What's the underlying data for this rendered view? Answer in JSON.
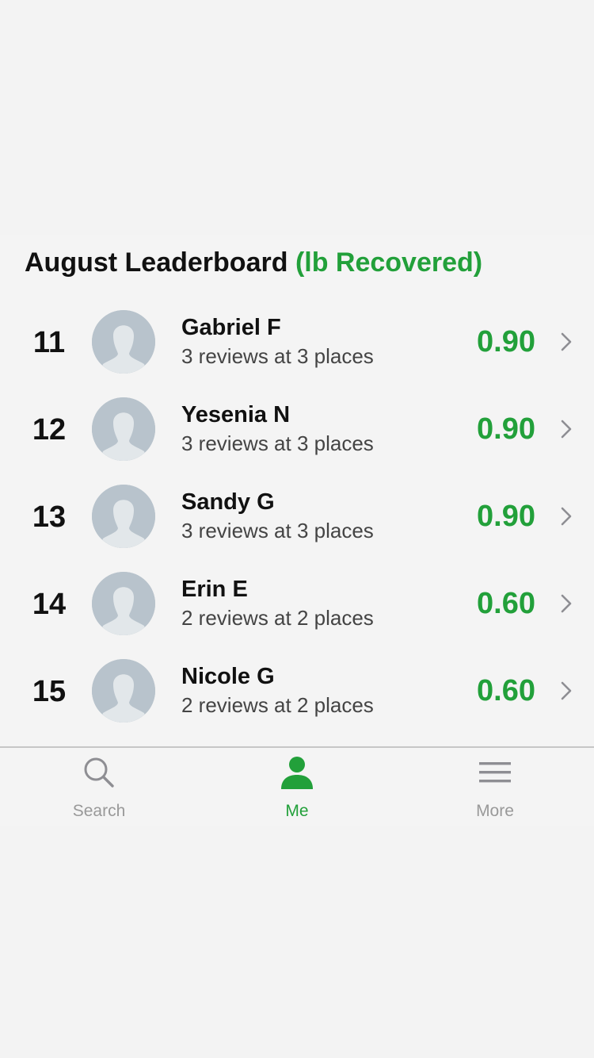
{
  "colors": {
    "accent": "#22a03a",
    "text": "#111111",
    "inactive": "#999999"
  },
  "leaderboard": {
    "title": "August Leaderboard",
    "unit": "(lb Recovered)",
    "rows": [
      {
        "rank": "11",
        "name": "Gabriel F",
        "summary": "3 reviews at 3 places",
        "score": "0.90",
        "avatar_icon": "default-avatar-icon"
      },
      {
        "rank": "12",
        "name": "Yesenia N",
        "summary": "3 reviews at 3 places",
        "score": "0.90",
        "avatar_icon": "default-avatar-icon"
      },
      {
        "rank": "13",
        "name": "Sandy G",
        "summary": "3 reviews at 3 places",
        "score": "0.90",
        "avatar_icon": "default-avatar-icon"
      },
      {
        "rank": "14",
        "name": "Erin E",
        "summary": "2 reviews at 2 places",
        "score": "0.60",
        "avatar_icon": "default-avatar-icon"
      },
      {
        "rank": "15",
        "name": "Nicole G",
        "summary": "2 reviews at 2 places",
        "score": "0.60",
        "avatar_icon": "default-avatar-icon"
      }
    ]
  },
  "tabbar": {
    "tabs": [
      {
        "label": "Search",
        "icon": "search-icon",
        "active": false
      },
      {
        "label": "Me",
        "icon": "person-icon",
        "active": true
      },
      {
        "label": "More",
        "icon": "menu-icon",
        "active": false
      }
    ]
  }
}
